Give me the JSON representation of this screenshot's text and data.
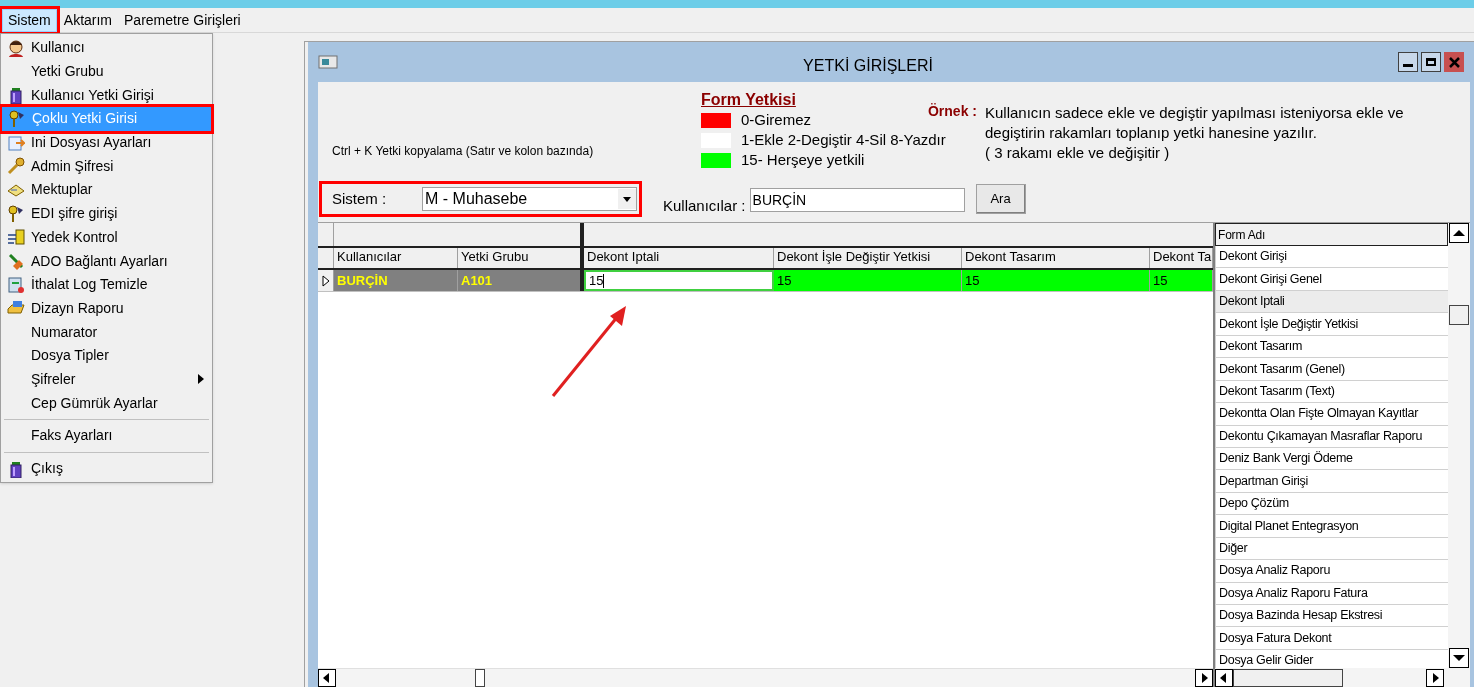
{
  "menu_bar": [
    {
      "label": "Sistem",
      "selected": true,
      "highlighted": true
    },
    {
      "label": "Aktarım",
      "selected": false,
      "highlighted": false
    },
    {
      "label": "Paremetre Girişleri",
      "selected": false,
      "highlighted": false
    }
  ],
  "dropdown": [
    {
      "kind": "item",
      "label": "Kullanıcı",
      "selected": false,
      "highlighted": false,
      "submenu": false
    },
    {
      "kind": "item",
      "label": "Yetki Grubu",
      "selected": false,
      "highlighted": false,
      "submenu": false
    },
    {
      "kind": "item",
      "label": "Kullanıcı Yetki Girişi",
      "selected": false,
      "highlighted": false,
      "submenu": false
    },
    {
      "kind": "item",
      "label": "Çoklu Yetki Girisi",
      "selected": true,
      "highlighted": true,
      "submenu": false
    },
    {
      "kind": "item",
      "label": "Ini Dosyası  Ayarları",
      "selected": false,
      "highlighted": false,
      "submenu": false
    },
    {
      "kind": "item",
      "label": "Admin Şifresi",
      "selected": false,
      "highlighted": false,
      "submenu": false
    },
    {
      "kind": "item",
      "label": "Mektuplar",
      "selected": false,
      "highlighted": false,
      "submenu": false
    },
    {
      "kind": "item",
      "label": "EDI şifre girişi",
      "selected": false,
      "highlighted": false,
      "submenu": false
    },
    {
      "kind": "item",
      "label": "Yedek Kontrol",
      "selected": false,
      "highlighted": false,
      "submenu": false
    },
    {
      "kind": "item",
      "label": "ADO Bağlantı Ayarları",
      "selected": false,
      "highlighted": false,
      "submenu": false
    },
    {
      "kind": "item",
      "label": "İthalat Log Temizle",
      "selected": false,
      "highlighted": false,
      "submenu": false
    },
    {
      "kind": "item",
      "label": "Dizayn Raporu",
      "selected": false,
      "highlighted": false,
      "submenu": false
    },
    {
      "kind": "item",
      "label": "Numarator",
      "selected": false,
      "highlighted": false,
      "submenu": false
    },
    {
      "kind": "item",
      "label": "Dosya Tipler",
      "selected": false,
      "highlighted": false,
      "submenu": false
    },
    {
      "kind": "item",
      "label": "Şifreler",
      "selected": false,
      "highlighted": false,
      "submenu": true
    },
    {
      "kind": "item",
      "label": "Cep Gümrük Ayarlar",
      "selected": false,
      "highlighted": false,
      "submenu": false
    },
    {
      "kind": "separator"
    },
    {
      "kind": "item",
      "label": "Faks Ayarları",
      "selected": false,
      "highlighted": false,
      "submenu": false
    },
    {
      "kind": "separator"
    },
    {
      "kind": "item",
      "label": "Çıkış",
      "selected": false,
      "highlighted": false,
      "submenu": false
    }
  ],
  "window": {
    "title": "YETKİ GİRİŞLERİ"
  },
  "hint": "Ctrl + K Yetki kopyalama (Satır ve kolon bazında)",
  "legend": {
    "title": "Form Yetkisi",
    "items": [
      {
        "color": "#ff0000",
        "label": "0-Giremez"
      },
      {
        "color": "#ffffff",
        "label": "1-Ekle  2-Degiştir  4-Sil  8-Yazdır"
      },
      {
        "color": "#00ff00",
        "label": "15- Herşeye yetkili"
      }
    ]
  },
  "example": {
    "label": "Örnek :",
    "lines": [
      "Kullanıcın sadece ekle ve degiştir yapılması isteniyorsa  ekle ve",
      "degiştirin rakamları toplanıp yetki hanesine yazılır.",
      "( 3 rakamı ekle ve değişitir )"
    ]
  },
  "system_select": {
    "label": "Sistem :",
    "value": "M - Muhasebe",
    "highlighted": true
  },
  "user_search": {
    "label": "Kullanıcılar :",
    "value": "BURÇİN",
    "button": "Ara"
  },
  "grid": {
    "columns": [
      {
        "label": "Kullanıcılar",
        "kind": "fixed"
      },
      {
        "label": "Yetki Grubu",
        "kind": "fixed"
      },
      {
        "label": "Dekont Iptali",
        "kind": "permission"
      },
      {
        "label": "Dekont İşle Değiştir Yetkisi",
        "kind": "permission"
      },
      {
        "label": "Dekont Tasarım",
        "kind": "permission"
      },
      {
        "label": "Dekont Ta",
        "kind": "permission"
      }
    ],
    "rows": [
      {
        "selected": true,
        "cells": [
          {
            "text": "BURÇİN"
          },
          {
            "text": "A101"
          },
          {
            "text": "15",
            "color": "#ffffff",
            "editing": true
          },
          {
            "text": "15",
            "color": "#00ff00",
            "editing": false
          },
          {
            "text": "15",
            "color": "#00ff00",
            "editing": false
          },
          {
            "text": "15",
            "color": "#00ff00",
            "editing": false
          }
        ]
      }
    ]
  },
  "form_list": {
    "header": "Form Adı",
    "items": [
      {
        "label": "Dekont Girişi",
        "selected": false
      },
      {
        "label": "Dekont Girişi Genel",
        "selected": false
      },
      {
        "label": "Dekont Iptali",
        "selected": true
      },
      {
        "label": "Dekont İşle Değiştir Yetkisi",
        "selected": false
      },
      {
        "label": "Dekont Tasarım",
        "selected": false
      },
      {
        "label": "Dekont Tasarım (Genel)",
        "selected": false
      },
      {
        "label": "Dekont Tasarım (Text)",
        "selected": false
      },
      {
        "label": "Dekontta Olan Fişte Olmayan Kayıtlar",
        "selected": false
      },
      {
        "label": "Dekontu Çıkamayan Masraflar Raporu",
        "selected": false
      },
      {
        "label": "Deniz Bank Vergi Ödeme",
        "selected": false
      },
      {
        "label": "Departman Girişi",
        "selected": false
      },
      {
        "label": "Depo Çözüm",
        "selected": false
      },
      {
        "label": "Digital Planet Entegrasyon",
        "selected": false
      },
      {
        "label": "Diğer",
        "selected": false
      },
      {
        "label": "Dosya Analiz Raporu",
        "selected": false
      },
      {
        "label": "Dosya Analiz Raporu Fatura",
        "selected": false
      },
      {
        "label": "Dosya Bazinda Hesap Ekstresi",
        "selected": false
      },
      {
        "label": "Dosya Fatura Dekont",
        "selected": false
      },
      {
        "label": "Dosya Gelir Gider",
        "selected": false
      }
    ]
  }
}
